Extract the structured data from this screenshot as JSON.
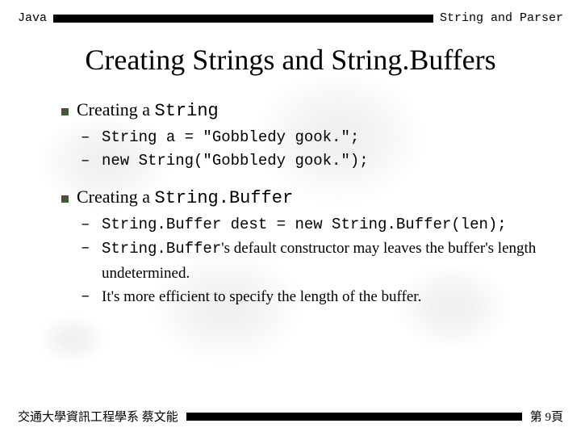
{
  "header": {
    "left": "Java",
    "right": "String and Parser"
  },
  "title": "Creating Strings and String.Buffers",
  "sections": [
    {
      "head_prefix": "Creating a ",
      "head_mono": "String",
      "items": [
        {
          "mono": true,
          "text": "String a = \"Gobbledy gook.\";"
        },
        {
          "mono": true,
          "text": "new String(\"Gobbledy gook.\");"
        }
      ]
    },
    {
      "head_prefix": "Creating a ",
      "head_mono": "String.Buffer",
      "items": [
        {
          "mono": true,
          "text": "String.Buffer dest = new String.Buffer(len);"
        },
        {
          "mono": false,
          "prefix_mono": "String.Buffer",
          "text": "'s default constructor may leaves the buffer's length undetermined."
        },
        {
          "mono": false,
          "text": "It's more efficient to specify the length of the buffer."
        }
      ]
    }
  ],
  "footer": {
    "left": "交通大學資訊工程學系 蔡文能",
    "right": "第 9頁"
  }
}
